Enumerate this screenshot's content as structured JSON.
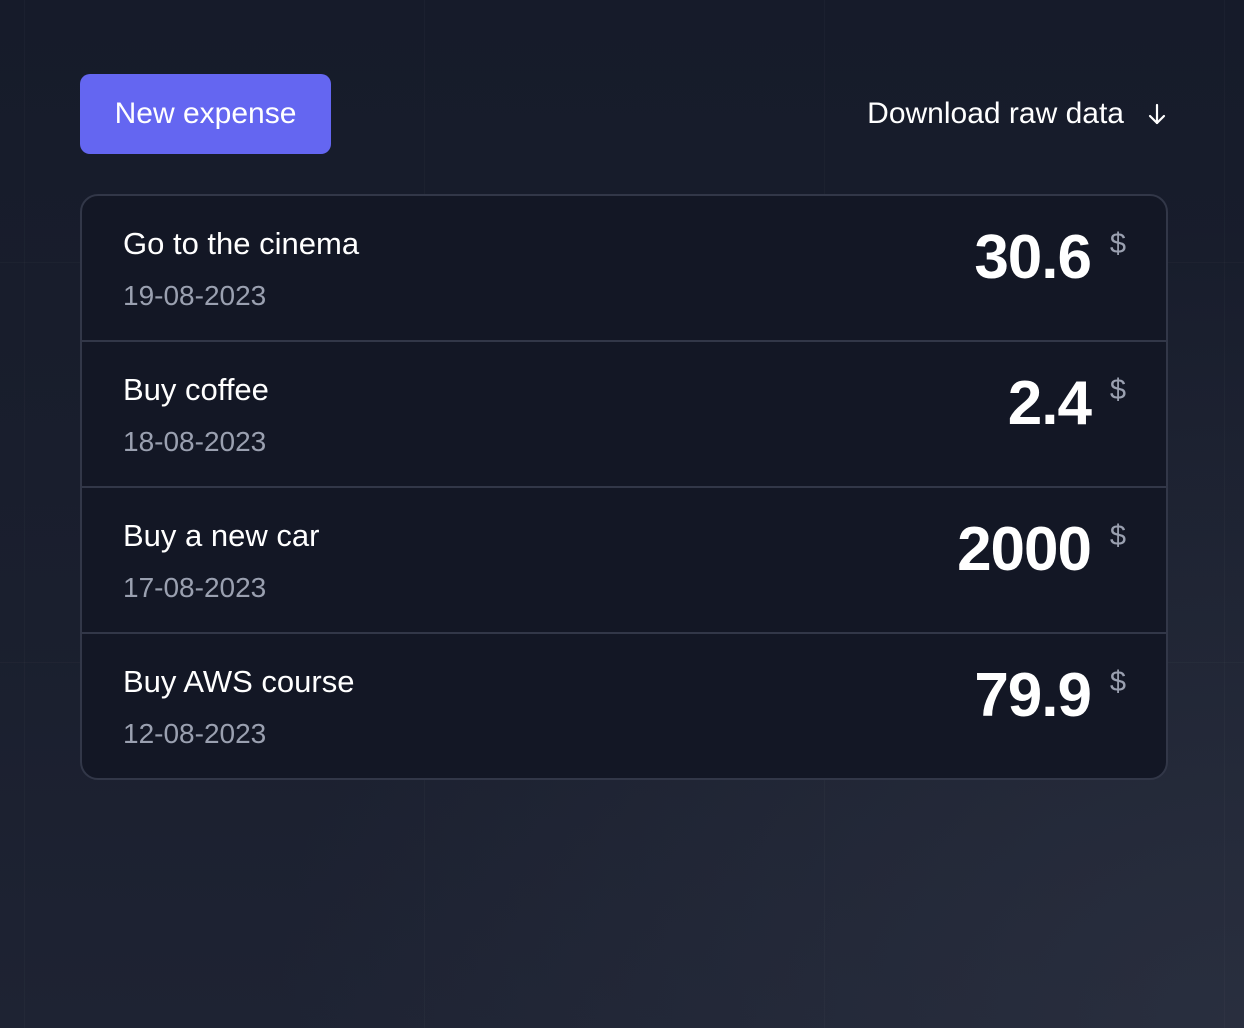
{
  "toolbar": {
    "new_expense_label": "New expense",
    "download_label": "Download raw data",
    "download_icon": "arrow-down-icon"
  },
  "colors": {
    "accent": "#6466f1",
    "background": "#181d2c",
    "card_background": "#131725",
    "border": "#323748",
    "muted_text": "#9aa0b0"
  },
  "expenses": [
    {
      "title": "Go to the cinema",
      "date": "19-08-2023",
      "amount": "30.6",
      "currency": "$"
    },
    {
      "title": "Buy coffee",
      "date": "18-08-2023",
      "amount": "2.4",
      "currency": "$"
    },
    {
      "title": "Buy a new car",
      "date": "17-08-2023",
      "amount": "2000",
      "currency": "$"
    },
    {
      "title": "Buy AWS course",
      "date": "12-08-2023",
      "amount": "79.9",
      "currency": "$"
    }
  ]
}
